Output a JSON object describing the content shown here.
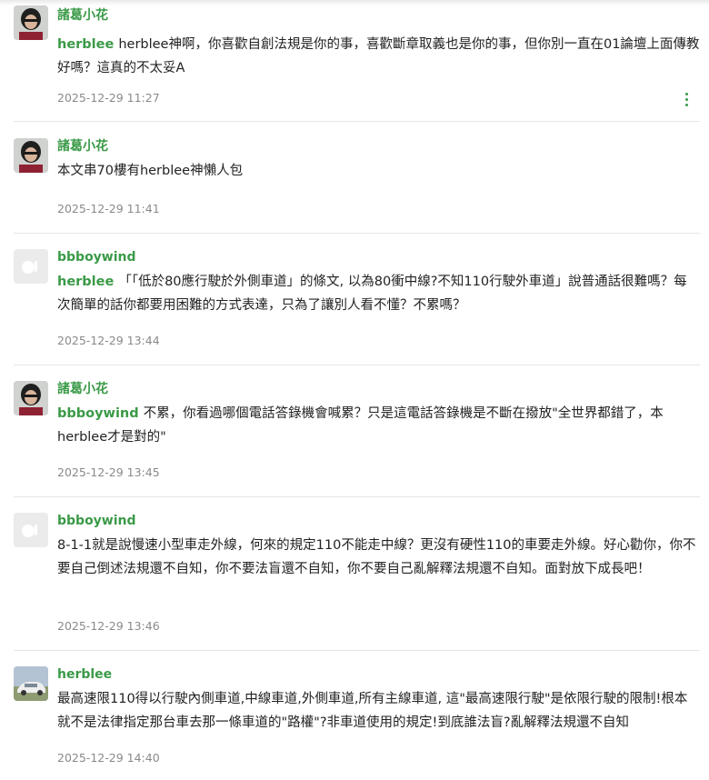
{
  "colors": {
    "accent": "#3a9a47",
    "text": "#222222",
    "muted": "#8a8a8a",
    "divider": "#e6e6e6"
  },
  "posts": [
    {
      "username": "諸葛小花",
      "avatar": "photo-avatar",
      "mention": "herblee",
      "text": "herblee神啊，你喜歡自創法規是你的事，喜歡斷章取義也是你的事，但你別一直在01論壇上面傳教好嗎？這真的不太妥A",
      "timestamp": "2025-12-29 11:27",
      "more_icon": "vertical-dots-icon"
    },
    {
      "username": "諸葛小花",
      "avatar": "photo-avatar",
      "mention": "",
      "text": "本文串70樓有herblee神懶人包",
      "timestamp": "2025-12-29 11:41"
    },
    {
      "username": "bbboywind",
      "avatar": "default-avatar-icon",
      "mention": "herblee",
      "text": "「「低於80應行駛於外側車道」的條文, 以為80衝中線?不知110行駛外車道」說普通話很難嗎？每次簡單的話你都要用困難的方式表達，只為了讓別人看不懂？不累嗎？",
      "timestamp": "2025-12-29 13:44"
    },
    {
      "username": "諸葛小花",
      "avatar": "photo-avatar",
      "mention": "bbboywind",
      "text": "不累，你看過哪個電話答錄機會喊累？只是這電話答錄機是不斷在撥放\"全世界都錯了，本herblee才是對的\"",
      "timestamp": "2025-12-29 13:45"
    },
    {
      "username": "bbboywind",
      "avatar": "default-avatar-icon",
      "mention": "",
      "text": "8-1-1就是說慢速小型車走外線，何來的規定110不能走中線？更沒有硬性110的車要走外線。好心勸你，你不要自己倒述法規還不自知，你不要法盲還不自知，你不要自己亂解釋法規還不自知。面對放下成長吧！",
      "timestamp": "2025-12-29 13:46"
    },
    {
      "username": "herblee",
      "avatar": "car-photo-avatar",
      "mention": "",
      "text": "最高速限110得以行駛內側車道,中線車道,外側車道,所有主線車道, 這\"最高速限行駛\"是依限行駛的限制!根本就不是法律指定那台車去那一條車道的\"路權\"?非車道使用的規定!到底誰法盲?亂解釋法規還不自知",
      "timestamp": "2025-12-29 14:40"
    }
  ]
}
